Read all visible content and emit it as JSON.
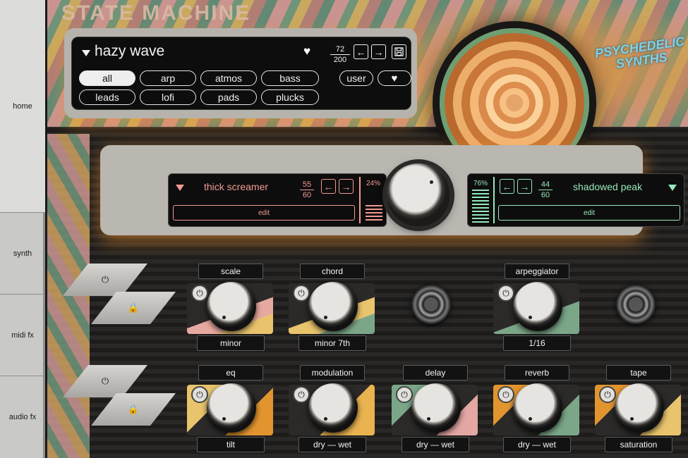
{
  "sidebar": {
    "items": [
      {
        "label": "home"
      },
      {
        "label": "synth"
      },
      {
        "label": "midi fx"
      },
      {
        "label": "audio fx"
      }
    ]
  },
  "branding": {
    "title": "STATE MACHINE",
    "logo": "PSYCHEDELIC SYNTHS"
  },
  "browser": {
    "preset_name": "hazy wave",
    "favorite_icon": "heart-icon",
    "counter_current": "72",
    "counter_total": "200",
    "prev_icon": "←",
    "next_icon": "→",
    "save_icon": "save-icon",
    "categories": [
      {
        "label": "all",
        "selected": true
      },
      {
        "label": "arp"
      },
      {
        "label": "atmos"
      },
      {
        "label": "bass"
      },
      {
        "label": "leads"
      },
      {
        "label": "lofi"
      },
      {
        "label": "pads"
      },
      {
        "label": "plucks"
      }
    ],
    "user_label": "user",
    "favorites_filter_icon": "heart-icon"
  },
  "layers": {
    "a": {
      "name": "thick screamer",
      "counter_current": "55",
      "counter_total": "60",
      "level": "24%",
      "edit_label": "edit",
      "color": "#f09a93"
    },
    "b": {
      "name": "shadowed peak",
      "counter_current": "44",
      "counter_total": "60",
      "level": "76%",
      "edit_label": "edit",
      "color": "#95e8bc"
    }
  },
  "midi_fx": [
    {
      "name": "scale",
      "value": "minor"
    },
    {
      "name": "chord",
      "value": "minor 7th"
    },
    {
      "name": "arpeggiator",
      "value": "1/16"
    }
  ],
  "audio_fx": [
    {
      "name": "eq",
      "value": "tilt"
    },
    {
      "name": "modulation",
      "value": "dry — wet"
    },
    {
      "name": "delay",
      "value": "dry — wet"
    },
    {
      "name": "reverb",
      "value": "dry — wet"
    },
    {
      "name": "tape",
      "value": "saturation"
    }
  ],
  "icons": {
    "power": "⏻",
    "lock": "🔒"
  }
}
